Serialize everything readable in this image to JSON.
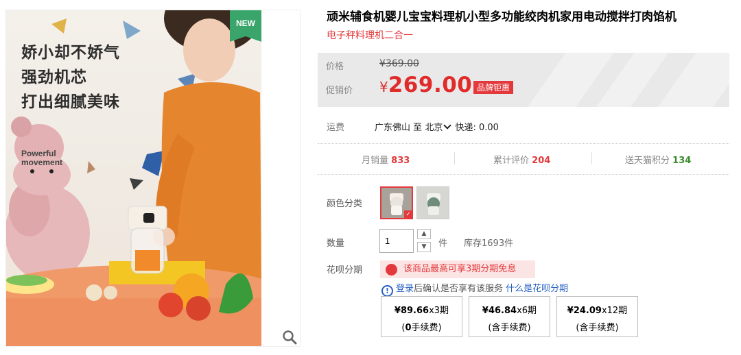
{
  "gallery": {
    "badge": "NEW",
    "headline": [
      "娇小却不娇气",
      "强劲机芯",
      "打出细腻美味"
    ],
    "powerful": [
      "Powerful",
      "movement"
    ],
    "icons": {
      "zoom": "search-icon"
    }
  },
  "product": {
    "title": "顽米辅食机婴儿宝宝料理机小型多功能绞肉机家用电动搅拌打肉馅机",
    "subtitle": "电子秤料理机二合一"
  },
  "price": {
    "label": "价格",
    "original": "¥369.00",
    "promo_label": "促销价",
    "currency": "¥",
    "promo": "269.00",
    "tag": "品牌钜惠"
  },
  "shipping": {
    "label": "运费",
    "from": "广东佛山",
    "to_word": "至",
    "to": "北京",
    "method": "快递: 0.00"
  },
  "stats": {
    "monthly_label": "月销量",
    "monthly_value": "833",
    "reviews_label": "累计评价",
    "reviews_value": "204",
    "points_label": "送天猫积分",
    "points_value": "134"
  },
  "options": {
    "color_label": "颜色分类",
    "qty_label": "数量",
    "qty_value": "1",
    "unit": "件",
    "stock": "库存1693件",
    "installment_label": "花呗分期"
  },
  "huabei": {
    "banner": "该商品最高可享3期分期免息",
    "login": "登录",
    "after_login": "后确认是否享有该服务",
    "what": "什么是花呗分期",
    "plans": [
      {
        "amount": "¥89.66",
        "term": "x3期",
        "fee_open": "(",
        "fee_strong": "0",
        "fee_rest": "手续费)"
      },
      {
        "amount": "¥46.84",
        "term": "x6期",
        "fee_open": "",
        "fee_strong": "",
        "fee_rest": "(含手续费)"
      },
      {
        "amount": "¥24.09",
        "term": "x12期",
        "fee_open": "",
        "fee_strong": "",
        "fee_rest": "(含手续费)"
      }
    ]
  },
  "colors": {
    "red": "#e4393c",
    "blue": "#2560c4",
    "green": "#3aa56b"
  }
}
